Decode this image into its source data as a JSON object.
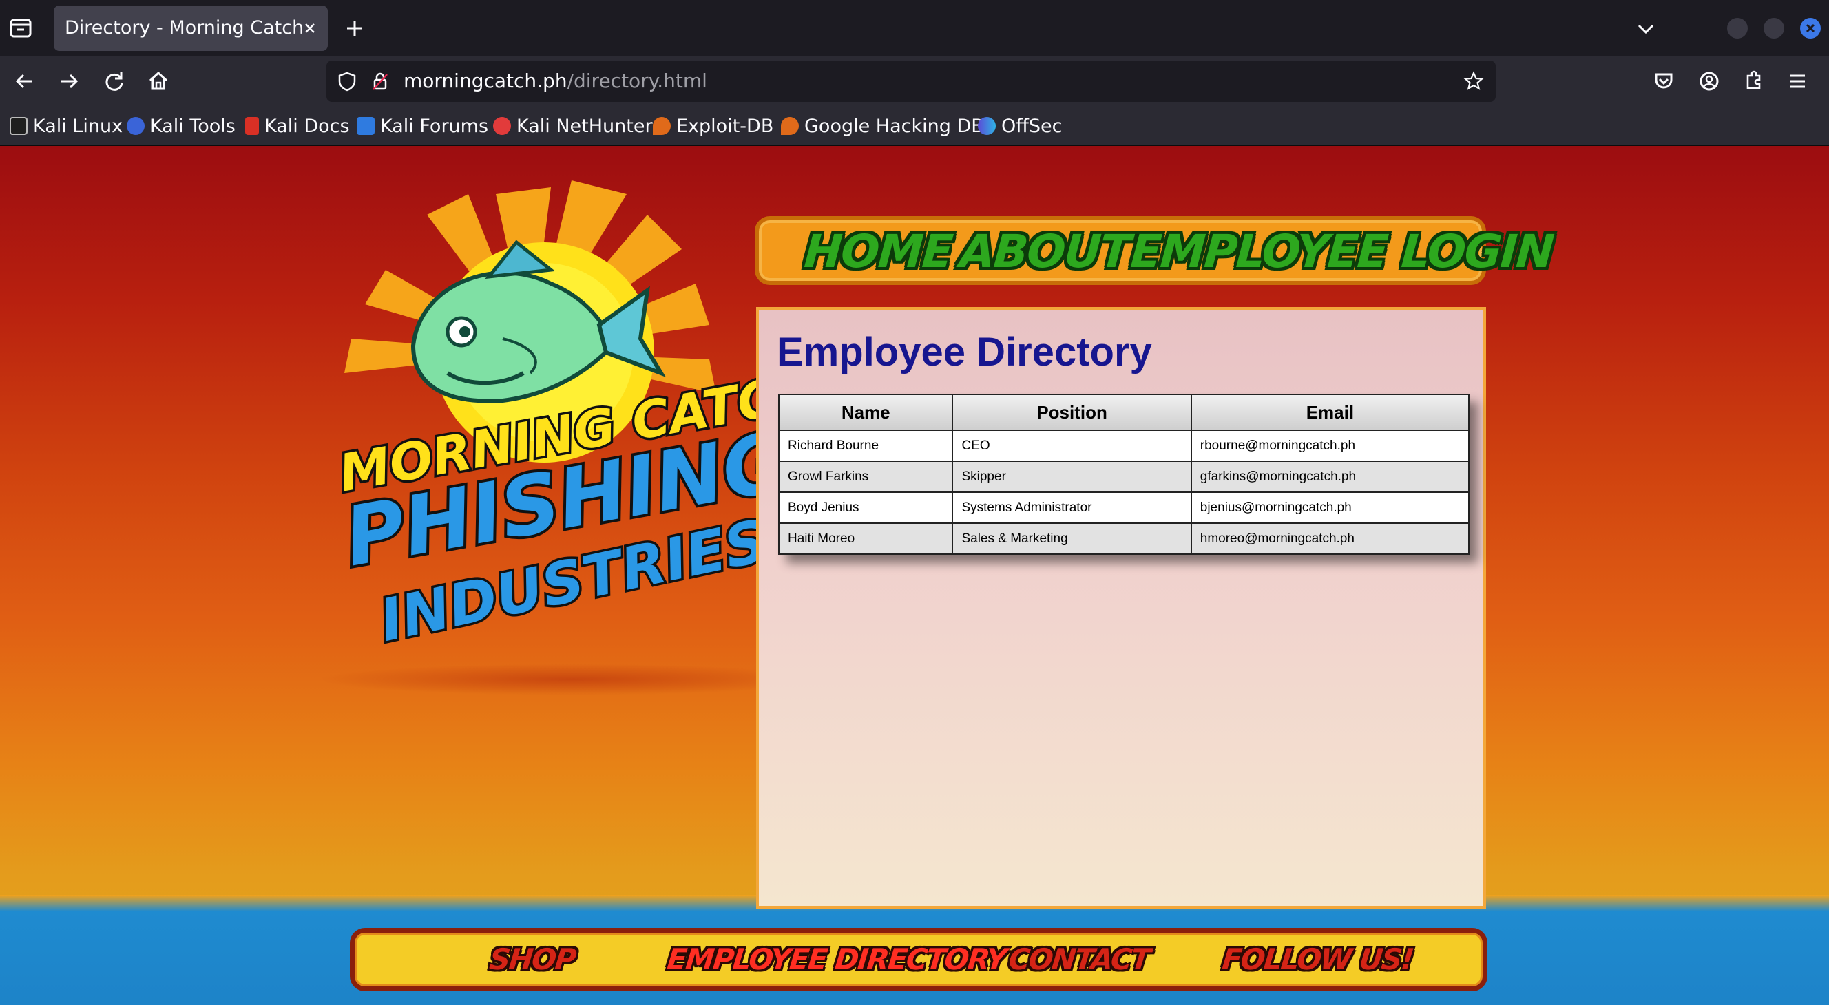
{
  "browser": {
    "tab_title": "Directory - Morning Catch",
    "url_host": "morningcatch.ph",
    "url_path": "/directory.html",
    "bookmarks": [
      {
        "label": "Kali Linux",
        "icon": "kali-dragon-icon",
        "color": "#1f1f1f"
      },
      {
        "label": "Kali Tools",
        "icon": "kali-tools-icon",
        "color": "#3a64d8"
      },
      {
        "label": "Kali Docs",
        "icon": "kali-docs-icon",
        "color": "#d93025"
      },
      {
        "label": "Kali Forums",
        "icon": "kali-forums-icon",
        "color": "#2f7be0"
      },
      {
        "label": "Kali NetHunter",
        "icon": "kali-nethunter-icon",
        "color": "#e23b3b"
      },
      {
        "label": "Exploit-DB",
        "icon": "exploit-db-icon",
        "color": "#e06a1a"
      },
      {
        "label": "Google Hacking DB",
        "icon": "ghdb-icon",
        "color": "#e06a1a"
      },
      {
        "label": "OffSec",
        "icon": "offsec-icon",
        "color": "#5b4bd6"
      }
    ]
  },
  "site": {
    "logo_text": [
      "MORNING CATCH",
      "PHISHING",
      "INDUSTRIES"
    ],
    "top_nav": [
      "HOME",
      "ABOUT",
      "EMPLOYEE LOGIN"
    ],
    "heading": "Employee Directory",
    "table": {
      "headers": [
        "Name",
        "Position",
        "Email"
      ],
      "rows": [
        [
          "Richard Bourne",
          "CEO",
          "rbourne@morningcatch.ph"
        ],
        [
          "Growl Farkins",
          "Skipper",
          "gfarkins@morningcatch.ph"
        ],
        [
          "Boyd Jenius",
          "Systems Administrator",
          "bjenius@morningcatch.ph"
        ],
        [
          "Haiti Moreo",
          "Sales & Marketing",
          "hmoreo@morningcatch.ph"
        ]
      ]
    },
    "bottom_nav": [
      "SHOP",
      "EMPLOYEE DIRECTORY",
      "CONTACT",
      "FOLLOW US!"
    ]
  }
}
